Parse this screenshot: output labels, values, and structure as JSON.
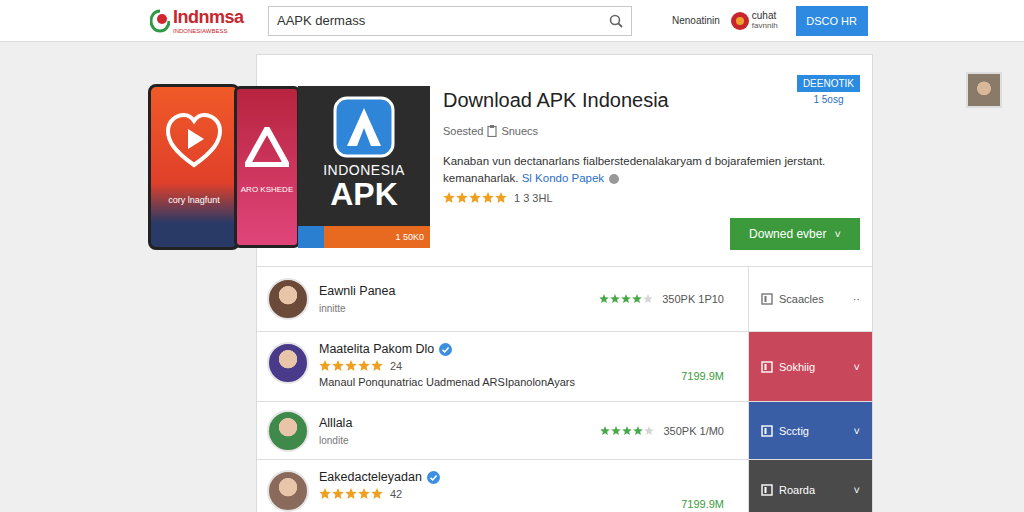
{
  "header": {
    "logo": "Indnmsa",
    "logo_sub": "INDONESIAWBESS",
    "search": {
      "value": "AAPK dermass"
    },
    "link": "Nenoatinin",
    "brand": "cuhat",
    "brand_sub": "favnnih",
    "button": "DSCO HR"
  },
  "gallery": {
    "tile1": "cory lnagfunt",
    "tile2": "ARO KSHEDE",
    "app_name": "INDONESIA",
    "app_badge": "APK",
    "app_count": "1 50K0"
  },
  "app": {
    "title": "Download APK Indonesia",
    "meta1": "Soested",
    "meta2": "Snuecs",
    "description": "Kanaban vun dectanarlans fialberstedenalakaryam d bojarafemien jerstant. kemanaharlak.",
    "link": "Sl Kondo Papek",
    "stars": 5,
    "rating": "1 3 3HL",
    "badge": "DEENOTIK",
    "badge_sub": "1 5osg",
    "download": "Downed evber",
    "download_arrow": "˅"
  },
  "rows": [
    {
      "kind": "simple",
      "name": "Eawnli Panea",
      "verified": false,
      "subtitle": "innitte",
      "stars": 4,
      "price": "350PK 1P10",
      "action": "Scaacles",
      "trailing": "··",
      "color": "#ffffff"
    },
    {
      "kind": "rated",
      "name": "Maatelita Pakom Dlo",
      "verified": true,
      "stars": 5,
      "count": "24",
      "subtitle": "Manaul Ponqunatriac Uadmenad ARSIpanolonAyars",
      "price": "7199.9M",
      "action": "Sokhiig",
      "trailing": "˅",
      "color": "#c9475a"
    },
    {
      "kind": "simple",
      "name": "Alllala",
      "verified": false,
      "subtitle": "londite",
      "stars": 4,
      "price": "350PK 1/M0",
      "action": "Scctig",
      "trailing": "˅",
      "color": "#3a5ea6"
    },
    {
      "kind": "rated",
      "name": "Eakedacteleyadan",
      "verified": true,
      "stars": 5,
      "count": "42",
      "subtitle": "",
      "price": "7199.9M",
      "action": "Roarda",
      "trailing": "˅",
      "color": "#4a4a4a"
    }
  ]
}
